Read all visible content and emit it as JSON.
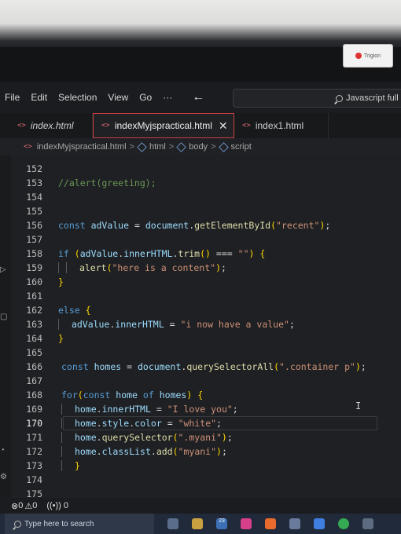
{
  "monitor": {
    "badge_text": "Trigion"
  },
  "menu": {
    "items": [
      "File",
      "Edit",
      "Selection",
      "View",
      "Go"
    ],
    "more": "···",
    "back": "←",
    "search_text": "Javascript full"
  },
  "tabs": [
    {
      "label": "index.html",
      "active": false
    },
    {
      "label": "indexMyjspractical.html",
      "active": true,
      "close": "✕"
    },
    {
      "label": "index1.html",
      "active": false
    }
  ],
  "breadcrumb": {
    "file": "indexMyjspractical.html",
    "html": "html",
    "body": "body",
    "script": "script",
    "sep": ">"
  },
  "editor": {
    "current_line": "170",
    "lines": [
      {
        "n": "152",
        "text": ""
      },
      {
        "n": "153",
        "text": "//alert(greeting);"
      },
      {
        "n": "154",
        "text": ""
      },
      {
        "n": "155",
        "text": ""
      },
      {
        "n": "156",
        "text": "const adValue = document.getElementById(\"recent\");"
      },
      {
        "n": "157",
        "text": ""
      },
      {
        "n": "158",
        "text": "if (adValue.innerHTML.trim() === \"\") {"
      },
      {
        "n": "159",
        "text": "alert(\"here is a content\");"
      },
      {
        "n": "160",
        "text": "}"
      },
      {
        "n": "161",
        "text": ""
      },
      {
        "n": "162",
        "text": "else {"
      },
      {
        "n": "163",
        "text": "adValue.innerHTML = \"i now have a value\";"
      },
      {
        "n": "164",
        "text": "}"
      },
      {
        "n": "165",
        "text": ""
      },
      {
        "n": "166",
        "text": "const homes = document.querySelectorAll(\".container p\");"
      },
      {
        "n": "167",
        "text": ""
      },
      {
        "n": "168",
        "text": "for(const home of homes) {"
      },
      {
        "n": "169",
        "text": "home.innerHTML = \"I love you\";"
      },
      {
        "n": "170",
        "text": "home.style.color = \"white\";"
      },
      {
        "n": "171",
        "text": "home.querySelector(\".myani\");"
      },
      {
        "n": "172",
        "text": "home.classList.add(\"myani\");"
      },
      {
        "n": "173",
        "text": "}"
      },
      {
        "n": "174",
        "text": ""
      },
      {
        "n": "175",
        "text": ""
      }
    ]
  },
  "status": {
    "errors": "0",
    "warnings": "0",
    "ports": "0"
  },
  "taskbar": {
    "search_placeholder": "Type here to search",
    "badge_count": "23"
  },
  "colors": {
    "keyword": "#569cd6",
    "identifier": "#9cdcfe",
    "function": "#dcdcaa",
    "string": "#ce9178",
    "comment": "#6a9955",
    "active_tab_border": "#c64040"
  }
}
